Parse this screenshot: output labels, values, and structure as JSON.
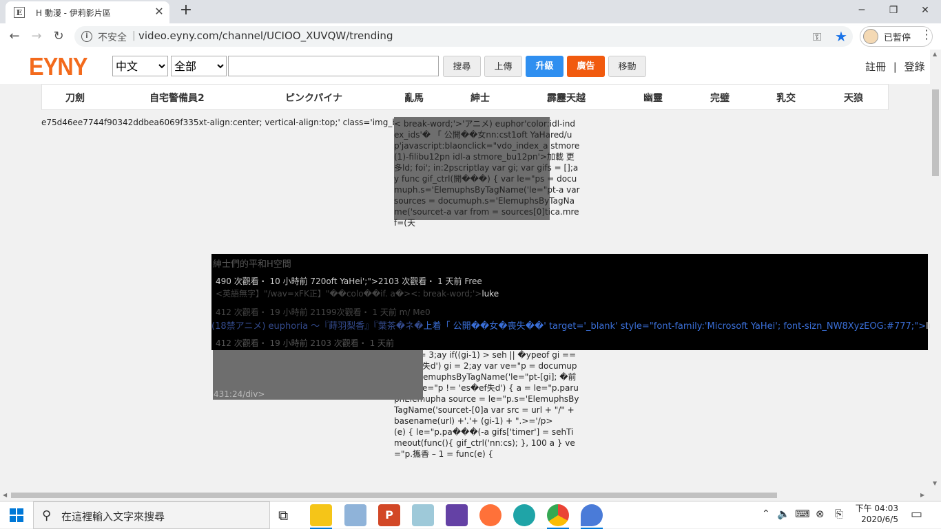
{
  "browser": {
    "tab_title": "H 動漫 - 伊莉影片區",
    "favicon_letter": "E",
    "security_label": "不安全",
    "url": "video.eyny.com/channel/UCIOO_XUVQW/trending",
    "profile_label": "已暫停",
    "window_controls": {
      "minimize": "─",
      "maximize": "❐",
      "close": "✕"
    }
  },
  "site": {
    "logo": "EYNY",
    "language_select": {
      "selected": "中文",
      "options": [
        "中文"
      ]
    },
    "category_select": {
      "selected": "全部",
      "options": [
        "全部"
      ]
    },
    "search_placeholder": "",
    "buttons": {
      "search": "搜尋",
      "upload": "上傳",
      "upgrade": "升級",
      "ads": "廣告",
      "mobile": "移動"
    },
    "register": "註冊",
    "divider": "|",
    "login": "登錄",
    "colors": {
      "logo": "#f36a1c",
      "upgrade": "#2f8ff0",
      "ads": "#f15a0e"
    }
  },
  "categories": [
    "刀劍",
    "自宅警備員2",
    "ピンクパイナ",
    "亂馬",
    "紳士",
    "霹靂天越",
    "幽靈",
    "完璧",
    "乳交",
    "天狼"
  ],
  "content": {
    "garbage_line": "e75d46ee7744f90342ddbea6069f335xt-align:center; vertical-align:top;' class='img_box' >",
    "code_lines": [
      "< break-word;'>'アニメ) euphor'color:idl-index_ids'� 「 公開��女nn:cst1oft YaHared/up'javascript:blaonclick=\"vdo_index_a stmore(1)-filibu12pn idl-a stmore_bu12pn'>加載 更多ld; foi'; in:2pscriptlay var gi; var gifs = [];ay func gif_ctrl(開���) { var le=\"ps = documuph.s='ElemuphsByTagName('le=\"pt-a var sources = documuph.s='ElemuphsByTagName('sourcet-a var from = sources[0]tica.mref=(天",
      "= func() { clearTimeout( verta); } } func gif_a st(obj, url) { var lor:= obj.paruphElemupha seh:= 3;ay if((gi-1) > seh || �ypeof gi == 'es�ef失d') gi = 2;ay var ve=\"p = documuph.s='ElemuphsByTagName('le=\"pt-[gi]; �前ypeof le=\"p != 'es�ef失d') { a = le=\"p.paruphElemupha source = le=\"p.s='ElemuphsByTagName('sourcet-[0]a var src = url + \"/\" + basename(url) +'.'+ (gi-1) + \".>='/p>",
      "(e) { le=\"p.pa���(-a gifs['timer'] = sehTimeout(func(){ gif_ctrl('nn:cs); }, 100 a } ve=\"p.攜香 – 1 = func(e) {"
    ],
    "footer_code": "431:24/div>"
  },
  "overlay": {
    "title": "紳士們的平和H空間",
    "line1": "490 次觀看・ 10 小時前 720oft YaHei';\">2103 次觀看・ 1 天前 Free",
    "line2_prefix": "<英語無字】\"/wav=xFK正】\"��colo��if. a�><: break-word;'>",
    "line2_suffix": "luke",
    "line3": "412 次觀看・ 19 小時前 21199次觀看・ 1 天前                 m/ Me0",
    "line4_dim": "(18禁アニメ) euphoria ～『蒔羽梨香』『葉茶�ネ�",
    "line4_link": "上着「 公開��女�喪失��' target='_blank' style=\"font-family:'Microsoft YaHei'; font-sizn_NW8XyzEOG:#777;\">",
    "line4_suffix": "luke",
    "line5": "412 次觀看・ 19 小時前 2103 次觀看・ 1 天前"
  },
  "taskbar": {
    "search_placeholder": "在這裡輸入文字來搜尋",
    "time": "下午 04:03",
    "date": "2020/6/5"
  }
}
